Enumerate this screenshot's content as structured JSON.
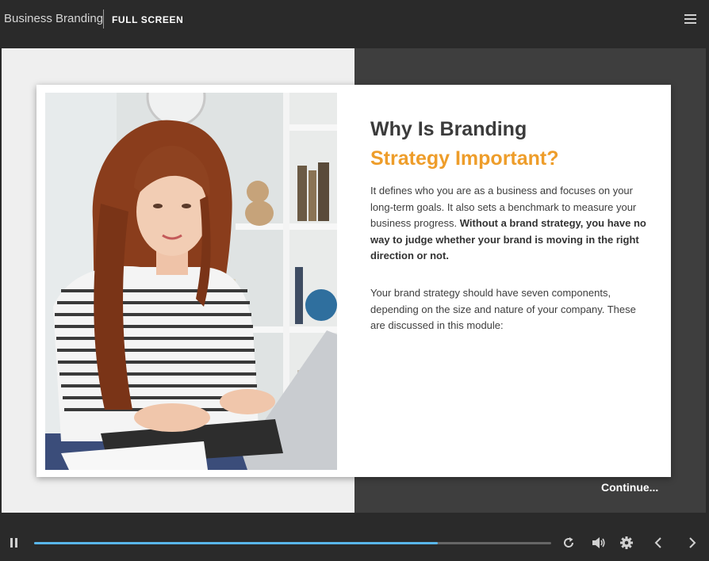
{
  "header": {
    "course_title": "Business Branding",
    "fullscreen_label": "FULL SCREEN",
    "menu_icon": "hamburger-menu-icon"
  },
  "slide": {
    "heading_line1": "Why Is Branding",
    "heading_line2": "Strategy Important?",
    "paragraph1_plain": "It defines who you are as a business and focuses on your long-term goals. It also sets a benchmark to measure your business progress. ",
    "paragraph1_bold": "Without a brand strategy, you have no way to judge whether your brand is moving in the right direction or not.",
    "paragraph2": "Your brand strategy should have seven components, depending on the size and nature of your company. These are discussed in this module:",
    "image_alt": "Woman with long red hair typing on a laptop",
    "continue_label": "Continue..."
  },
  "player": {
    "progress_fraction": 0.78,
    "icons": {
      "pause": "pause-icon",
      "replay": "replay-icon",
      "volume": "volume-icon",
      "settings": "gear-icon",
      "previous": "chevron-left-icon",
      "next": "chevron-right-icon"
    }
  },
  "colors": {
    "accent_orange": "#ee9d2a",
    "heading_dark": "#3b3b3b",
    "progress_blue": "#59b6ea",
    "bar_background": "#2a2a2a"
  }
}
